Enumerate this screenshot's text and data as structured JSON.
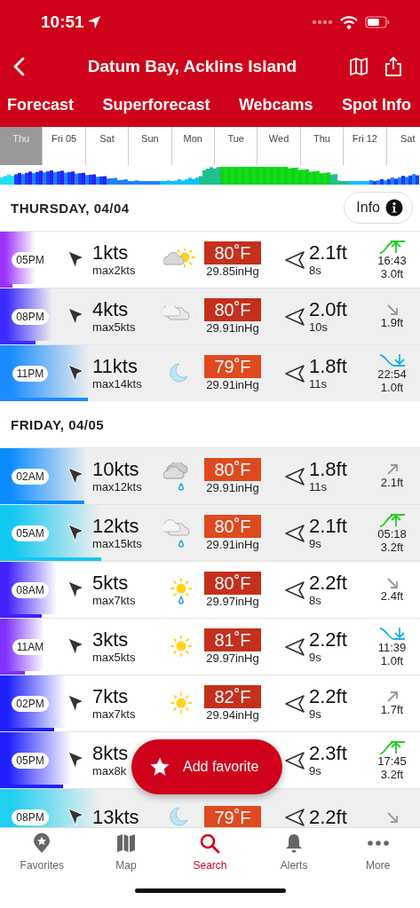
{
  "status_bar": {
    "time": "10:51"
  },
  "header": {
    "title": "Datum Bay, Acklins Island"
  },
  "tabs": [
    {
      "label": "Forecast"
    },
    {
      "label": "Superforecast"
    },
    {
      "label": "Webcams"
    },
    {
      "label": "Spot Info"
    }
  ],
  "day_strip": [
    {
      "label": "Thu",
      "selected": true
    },
    {
      "label": "Fri 05",
      "selected": false
    },
    {
      "label": "Sat",
      "selected": false
    },
    {
      "label": "Sun",
      "selected": false
    },
    {
      "label": "Mon",
      "selected": false
    },
    {
      "label": "Tue",
      "selected": false
    },
    {
      "label": "Wed",
      "selected": false
    },
    {
      "label": "Thu",
      "selected": false
    },
    {
      "label": "Fri 12",
      "selected": false
    },
    {
      "label": "Sat",
      "selected": false
    }
  ],
  "info_button": {
    "label": "Info"
  },
  "days": [
    {
      "title": "THURSDAY, 04/04",
      "rows": [
        {
          "time": "05PM",
          "night": false,
          "wind": "1kts",
          "gust": "max2kts",
          "color": "#9b30ff",
          "level": 0.03,
          "weather": {
            "kind": "partly-sunny",
            "rain": false
          },
          "temp": {
            "text": "80˚F",
            "color": "#c4301c"
          },
          "pressure": "29.85inHg",
          "swell": "2.1ft",
          "period": "8s",
          "tide": {
            "kind": "high",
            "time": "16:43",
            "height": "3.0ft"
          }
        },
        {
          "time": "08PM",
          "night": true,
          "wind": "4kts",
          "gust": "max5kts",
          "color": "#3a2cff",
          "level": 0.085,
          "weather": {
            "kind": "night-cloudy",
            "rain": false
          },
          "temp": {
            "text": "80˚F",
            "color": "#c4301c"
          },
          "pressure": "29.91inHg",
          "swell": "2.0ft",
          "period": "10s",
          "tide": {
            "kind": "falling",
            "height": "1.9ft"
          }
        },
        {
          "time": "11PM",
          "night": true,
          "wind": "11kts",
          "gust": "max14kts",
          "color": "#1a8cff",
          "level": 0.21,
          "weather": {
            "kind": "moon",
            "rain": false
          },
          "temp": {
            "text": "79˚F",
            "color": "#e04a1f"
          },
          "pressure": "29.91inHg",
          "swell": "1.8ft",
          "period": "11s",
          "tide": {
            "kind": "low",
            "time": "22:54",
            "height": "1.0ft"
          }
        }
      ]
    },
    {
      "title": "FRIDAY, 04/05",
      "rows": [
        {
          "time": "02AM",
          "night": true,
          "wind": "10kts",
          "gust": "max12kts",
          "color": "#0a8cff",
          "level": 0.2,
          "weather": {
            "kind": "cloudy",
            "rain": true
          },
          "temp": {
            "text": "80˚F",
            "color": "#de4a1f"
          },
          "pressure": "29.91inHg",
          "swell": "1.8ft",
          "period": "11s",
          "tide": {
            "kind": "rising",
            "height": "2.1ft"
          }
        },
        {
          "time": "05AM",
          "night": true,
          "wind": "12kts",
          "gust": "max15kts",
          "color": "#10c8f0",
          "level": 0.24,
          "weather": {
            "kind": "night-cloudy",
            "rain": true
          },
          "temp": {
            "text": "80˚F",
            "color": "#de4a1f"
          },
          "pressure": "29.91inHg",
          "swell": "2.1ft",
          "period": "9s",
          "tide": {
            "kind": "high",
            "time": "05:18",
            "height": "3.2ft"
          }
        },
        {
          "time": "08AM",
          "night": false,
          "wind": "5kts",
          "gust": "max7kts",
          "color": "#4020ff",
          "level": 0.1,
          "weather": {
            "kind": "sun",
            "rain": true
          },
          "temp": {
            "text": "80˚F",
            "color": "#c4301c"
          },
          "pressure": "29.97inHg",
          "swell": "2.2ft",
          "period": "8s",
          "tide": {
            "kind": "falling",
            "height": "2.4ft"
          }
        },
        {
          "time": "11AM",
          "night": false,
          "wind": "3kts",
          "gust": "max5kts",
          "color": "#8030ff",
          "level": 0.06,
          "weather": {
            "kind": "sun",
            "rain": false
          },
          "temp": {
            "text": "81˚F",
            "color": "#c4301c"
          },
          "pressure": "29.97inHg",
          "swell": "2.2ft",
          "period": "9s",
          "tide": {
            "kind": "low",
            "time": "11:39",
            "height": "1.0ft"
          }
        },
        {
          "time": "02PM",
          "night": false,
          "wind": "7kts",
          "gust": "max7kts",
          "color": "#2020ff",
          "level": 0.13,
          "weather": {
            "kind": "sun",
            "rain": false
          },
          "temp": {
            "text": "82˚F",
            "color": "#c4301c"
          },
          "pressure": "29.94inHg",
          "swell": "2.2ft",
          "period": "9s",
          "tide": {
            "kind": "rising",
            "height": "1.7ft"
          }
        },
        {
          "time": "05PM",
          "night": false,
          "wind": "8kts",
          "gust": "max8k",
          "color": "#2020ff",
          "level": 0.15,
          "swell": "2.3ft",
          "period": "9s",
          "tide": {
            "kind": "high",
            "time": "17:45",
            "height": "3.2ft"
          }
        },
        {
          "time": "08PM",
          "night": true,
          "wind": "13kts",
          "color": "#20d0f0",
          "weather": {
            "kind": "moon",
            "rain": false
          },
          "temp": {
            "text": "79˚F",
            "color": "#e04a1f"
          },
          "swell": "2.2ft",
          "tide": {
            "kind": "falling"
          }
        }
      ]
    }
  ],
  "fab": {
    "label": "Add favorite"
  },
  "bottom_nav": [
    {
      "label": "Favorites",
      "selected": false
    },
    {
      "label": "Map",
      "selected": false
    },
    {
      "label": "Search",
      "selected": true
    },
    {
      "label": "Alerts",
      "selected": false
    },
    {
      "label": "More",
      "selected": false
    }
  ]
}
